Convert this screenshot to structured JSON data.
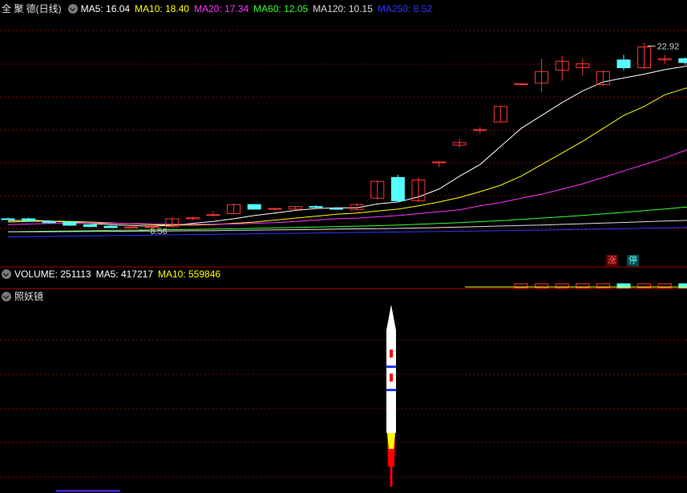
{
  "header": {
    "title": "全 聚 德(日线)",
    "ma": [
      {
        "label": "MA5: 16.04",
        "color": "#ffffff"
      },
      {
        "label": "MA10: 18.40",
        "color": "#ffff00"
      },
      {
        "label": "MA20: 17.34",
        "color": "#ff33ff"
      },
      {
        "label": "MA60: 12.05",
        "color": "#33ff33"
      },
      {
        "label": "MA120: 10.15",
        "color": "#dddddd"
      },
      {
        "label": "MA250: 8.52",
        "color": "#3333ff"
      }
    ]
  },
  "volume_header": {
    "vol": "VOLUME: 251113",
    "ma5": "MA5: 417217",
    "ma10": "MA10: 559846"
  },
  "indicator_header": {
    "title": "照妖镜"
  },
  "badges": {
    "up": "涨",
    "halt": "停"
  },
  "colors": {
    "up": "#ff3333",
    "down": "#54ffff",
    "grid": "#8b0000",
    "rocket_body": "#ffffff",
    "rocket_flame": "#ff0000"
  },
  "chart_data": {
    "type": "candlestick",
    "price_ylim": [
      7.0,
      25.0
    ],
    "annotations": [
      {
        "text": "8.56",
        "index": 7,
        "value": 8.56,
        "kind": "low"
      },
      {
        "text": "22.92",
        "index": 31,
        "value": 22.92,
        "kind": "high"
      }
    ],
    "candles": [
      {
        "o": 9.3,
        "h": 9.4,
        "l": 9.2,
        "c": 9.25
      },
      {
        "o": 9.3,
        "h": 9.4,
        "l": 9.1,
        "c": 9.15
      },
      {
        "o": 9.1,
        "h": 9.2,
        "l": 8.95,
        "c": 9.0
      },
      {
        "o": 9.05,
        "h": 9.15,
        "l": 8.75,
        "c": 8.8
      },
      {
        "o": 8.85,
        "h": 8.9,
        "l": 8.65,
        "c": 8.7
      },
      {
        "o": 8.72,
        "h": 8.8,
        "l": 8.6,
        "c": 8.62
      },
      {
        "o": 8.64,
        "h": 8.72,
        "l": 8.56,
        "c": 8.66
      },
      {
        "o": 8.68,
        "h": 8.8,
        "l": 8.56,
        "c": 8.7
      },
      {
        "o": 8.7,
        "h": 9.4,
        "l": 8.65,
        "c": 9.3
      },
      {
        "o": 9.3,
        "h": 9.45,
        "l": 9.2,
        "c": 9.38
      },
      {
        "o": 9.6,
        "h": 9.9,
        "l": 9.5,
        "c": 9.62
      },
      {
        "o": 9.7,
        "h": 10.5,
        "l": 9.65,
        "c": 10.4
      },
      {
        "o": 10.4,
        "h": 10.45,
        "l": 10.0,
        "c": 10.05
      },
      {
        "o": 10.05,
        "h": 10.15,
        "l": 9.95,
        "c": 10.1
      },
      {
        "o": 10.05,
        "h": 10.3,
        "l": 10.0,
        "c": 10.25
      },
      {
        "o": 10.25,
        "h": 10.35,
        "l": 10.1,
        "c": 10.2
      },
      {
        "o": 10.1,
        "h": 10.2,
        "l": 10.0,
        "c": 10.05
      },
      {
        "o": 10.0,
        "h": 10.5,
        "l": 9.95,
        "c": 10.4
      },
      {
        "o": 10.9,
        "h": 12.3,
        "l": 10.8,
        "c": 12.2
      },
      {
        "o": 12.5,
        "h": 12.7,
        "l": 10.6,
        "c": 10.7
      },
      {
        "o": 10.7,
        "h": 12.5,
        "l": 10.6,
        "c": 12.3
      },
      {
        "o": 13.7,
        "h": 13.75,
        "l": 13.3,
        "c": 13.7
      },
      {
        "o": 15.0,
        "h": 15.5,
        "l": 14.8,
        "c": 15.2
      },
      {
        "o": 16.2,
        "h": 16.4,
        "l": 15.9,
        "c": 16.2
      },
      {
        "o": 16.8,
        "h": 18.0,
        "l": 16.8,
        "c": 18.0
      },
      {
        "o": 19.7,
        "h": 19.8,
        "l": 19.7,
        "c": 19.75
      },
      {
        "o": 19.8,
        "h": 21.7,
        "l": 19.1,
        "c": 20.7
      },
      {
        "o": 20.8,
        "h": 21.9,
        "l": 20.0,
        "c": 21.5
      },
      {
        "o": 21.0,
        "h": 21.7,
        "l": 20.4,
        "c": 21.3
      },
      {
        "o": 19.7,
        "h": 20.8,
        "l": 19.6,
        "c": 20.7
      },
      {
        "o": 21.6,
        "h": 22.0,
        "l": 20.8,
        "c": 21.0
      },
      {
        "o": 21.0,
        "h": 22.92,
        "l": 20.9,
        "c": 22.6
      },
      {
        "o": 21.6,
        "h": 22.0,
        "l": 21.3,
        "c": 21.7
      },
      {
        "o": 21.7,
        "h": 21.8,
        "l": 21.2,
        "c": 21.4
      },
      {
        "o": 21.8,
        "h": 21.9,
        "l": 21.4,
        "c": 21.5
      }
    ],
    "ma_lines": [
      {
        "name": "MA5",
        "color": "#ffffff",
        "values": [
          9.15,
          9.2,
          9.12,
          9.03,
          8.95,
          8.85,
          8.78,
          8.72,
          8.8,
          8.95,
          9.1,
          9.3,
          9.55,
          9.75,
          9.95,
          10.1,
          10.15,
          10.15,
          10.45,
          10.6,
          11.0,
          11.6,
          12.6,
          13.5,
          14.9,
          16.3,
          17.3,
          18.3,
          19.2,
          19.9,
          20.2,
          20.5,
          20.85,
          21.1,
          21.2
        ]
      },
      {
        "name": "MA10",
        "color": "#ffff00",
        "values": [
          9.05,
          9.1,
          9.12,
          9.1,
          9.05,
          8.98,
          8.92,
          8.85,
          8.82,
          8.82,
          8.85,
          8.95,
          9.05,
          9.2,
          9.35,
          9.5,
          9.65,
          9.75,
          9.9,
          10.05,
          10.3,
          10.6,
          10.95,
          11.4,
          11.9,
          12.6,
          13.5,
          14.4,
          15.3,
          16.3,
          17.3,
          18.0,
          18.9,
          19.4,
          19.7
        ]
      },
      {
        "name": "MA20",
        "color": "#ff33ff",
        "values": [
          8.85,
          8.9,
          8.93,
          8.95,
          8.96,
          8.95,
          8.93,
          8.9,
          8.88,
          8.87,
          8.88,
          8.9,
          8.95,
          9.0,
          9.1,
          9.2,
          9.3,
          9.35,
          9.45,
          9.55,
          9.7,
          9.85,
          10.0,
          10.3,
          10.55,
          10.9,
          11.2,
          11.6,
          12.0,
          12.5,
          13.0,
          13.5,
          14.0,
          14.6,
          15.1
        ]
      },
      {
        "name": "MA60",
        "color": "#33ff33",
        "values": [
          8.3,
          8.32,
          8.34,
          8.36,
          8.38,
          8.4,
          8.42,
          8.44,
          8.46,
          8.48,
          8.5,
          8.53,
          8.56,
          8.6,
          8.63,
          8.66,
          8.7,
          8.73,
          8.77,
          8.82,
          8.88,
          8.94,
          9.0,
          9.08,
          9.16,
          9.25,
          9.35,
          9.45,
          9.56,
          9.68,
          9.8,
          9.93,
          10.06,
          10.2,
          10.34
        ]
      },
      {
        "name": "MA120",
        "color": "#dddddd",
        "values": [
          8.3,
          8.3,
          8.3,
          8.31,
          8.32,
          8.33,
          8.34,
          8.35,
          8.36,
          8.37,
          8.38,
          8.4,
          8.42,
          8.44,
          8.46,
          8.48,
          8.5,
          8.52,
          8.54,
          8.56,
          8.59,
          8.62,
          8.66,
          8.7,
          8.74,
          8.78,
          8.82,
          8.87,
          8.92,
          8.97,
          9.02,
          9.07,
          9.12,
          9.17,
          9.22
        ]
      },
      {
        "name": "MA250",
        "color": "#3333ff",
        "values": [
          7.9,
          7.92,
          7.94,
          7.96,
          7.98,
          8.0,
          8.02,
          8.04,
          8.06,
          8.08,
          8.1,
          8.12,
          8.14,
          8.16,
          8.18,
          8.2,
          8.22,
          8.24,
          8.26,
          8.28,
          8.3,
          8.32,
          8.34,
          8.36,
          8.38,
          8.4,
          8.42,
          8.45,
          8.48,
          8.51,
          8.54,
          8.57,
          8.6,
          8.63,
          8.66
        ]
      }
    ]
  }
}
